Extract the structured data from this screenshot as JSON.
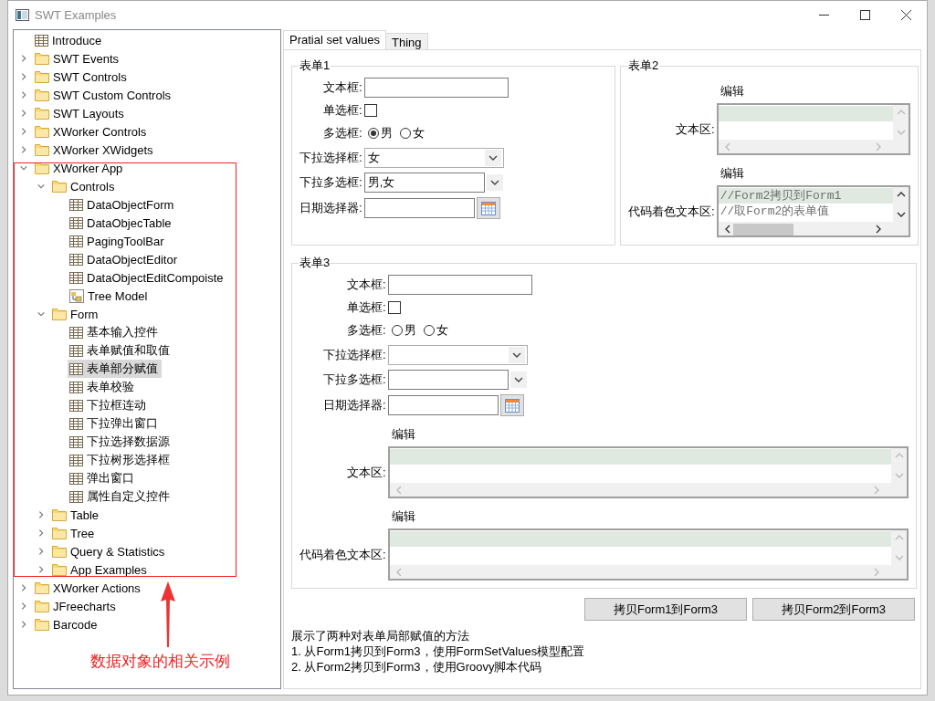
{
  "window": {
    "title": "SWT Examples"
  },
  "tree": [
    {
      "label": "Introduce",
      "kind": "page",
      "selected": false
    },
    {
      "label": "SWT Events",
      "kind": "folder",
      "expanded": false,
      "selected": false
    },
    {
      "label": "SWT Controls",
      "kind": "folder",
      "expanded": false,
      "selected": false
    },
    {
      "label": "SWT Custom Controls",
      "kind": "folder",
      "expanded": false,
      "selected": false
    },
    {
      "label": "SWT Layouts",
      "kind": "folder",
      "expanded": false,
      "selected": false
    },
    {
      "label": "XWorker Controls",
      "kind": "folder",
      "expanded": false,
      "selected": false
    },
    {
      "label": "XWorker XWidgets",
      "kind": "folder",
      "expanded": false,
      "selected": false
    },
    {
      "label": "XWorker App",
      "kind": "folder",
      "expanded": true,
      "selected": false,
      "children": [
        {
          "label": "Controls",
          "kind": "folder",
          "expanded": true,
          "selected": false,
          "children": [
            {
              "label": "DataObjectForm",
              "kind": "page",
              "selected": false
            },
            {
              "label": "DataObjecTable",
              "kind": "page",
              "selected": false
            },
            {
              "label": "PagingToolBar",
              "kind": "page",
              "selected": false
            },
            {
              "label": "DataObjectEditor",
              "kind": "page",
              "selected": false
            },
            {
              "label": "DataObjectEditCompoiste",
              "kind": "page",
              "selected": false
            },
            {
              "label": "Tree Model",
              "kind": "model",
              "selected": false
            }
          ]
        },
        {
          "label": "Form",
          "kind": "folder",
          "expanded": true,
          "selected": false,
          "children": [
            {
              "label": "基本输入控件",
              "kind": "page",
              "selected": false
            },
            {
              "label": "表单赋值和取值",
              "kind": "page",
              "selected": false
            },
            {
              "label": "表单部分赋值",
              "kind": "page",
              "selected": true
            },
            {
              "label": "表单校验",
              "kind": "page",
              "selected": false
            },
            {
              "label": "下拉框连动",
              "kind": "page",
              "selected": false
            },
            {
              "label": "下拉弹出窗口",
              "kind": "page",
              "selected": false
            },
            {
              "label": "下拉选择数据源",
              "kind": "page",
              "selected": false
            },
            {
              "label": "下拉树形选择框",
              "kind": "page",
              "selected": false
            },
            {
              "label": "弹出窗口",
              "kind": "page",
              "selected": false
            },
            {
              "label": "属性自定义控件",
              "kind": "page",
              "selected": false
            }
          ]
        },
        {
          "label": "Table",
          "kind": "folder",
          "expanded": false,
          "selected": false
        },
        {
          "label": "Tree",
          "kind": "folder",
          "expanded": false,
          "selected": false
        },
        {
          "label": "Query & Statistics",
          "kind": "folder",
          "expanded": false,
          "selected": false
        },
        {
          "label": "App Examples",
          "kind": "folder",
          "expanded": false,
          "selected": false
        }
      ]
    },
    {
      "label": "XWorker Actions",
      "kind": "folder",
      "expanded": false,
      "selected": false
    },
    {
      "label": "JFreecharts",
      "kind": "folder",
      "expanded": false,
      "selected": false
    },
    {
      "label": "Barcode",
      "kind": "folder",
      "expanded": false,
      "selected": false
    }
  ],
  "annotation": {
    "text": "数据对象的相关示例"
  },
  "tabs": [
    {
      "label": "Pratial set values",
      "selected": true
    },
    {
      "label": "Thing",
      "selected": false
    }
  ],
  "forms": [
    {
      "title": "表单1",
      "fields": [
        {
          "kind": "text",
          "label": "文本框:"
        },
        {
          "kind": "checkbox",
          "label": "单选框:",
          "checked": false
        },
        {
          "kind": "radio",
          "label": "多选框:",
          "options": [
            {
              "label": "男",
              "selected": true
            },
            {
              "label": "女",
              "selected": false
            }
          ]
        },
        {
          "kind": "select",
          "label": "下拉选择框:",
          "value": "女"
        },
        {
          "kind": "multiselect",
          "label": "下拉多选框:",
          "value": "男,女"
        },
        {
          "kind": "date",
          "label": "日期选择器:"
        }
      ]
    },
    {
      "title": "表单2",
      "fields": [
        {
          "kind": "textarea",
          "label": "文本区:",
          "caption": "编辑"
        },
        {
          "kind": "code",
          "label": "代码着色文本区:",
          "caption": "编辑",
          "lines": [
            "//Form2拷贝到Form1",
            "//取Form2的表单值"
          ]
        }
      ]
    },
    {
      "title": "表单3",
      "fields": [
        {
          "kind": "text",
          "label": "文本框:"
        },
        {
          "kind": "checkbox",
          "label": "单选框:",
          "checked": false
        },
        {
          "kind": "radio",
          "label": "多选框:",
          "options": [
            {
              "label": "男",
              "selected": false
            },
            {
              "label": "女",
              "selected": false
            }
          ]
        },
        {
          "kind": "select",
          "label": "下拉选择框:"
        },
        {
          "kind": "multiselect",
          "label": "下拉多选框:"
        },
        {
          "kind": "date",
          "label": "日期选择器:"
        },
        {
          "kind": "textarea",
          "label": "文本区:",
          "caption": "编辑"
        },
        {
          "kind": "code",
          "label": "代码着色文本区:",
          "caption": "编辑"
        }
      ]
    }
  ],
  "buttons": [
    "拷贝Form1到Form3",
    "拷贝Form2到Form3"
  ],
  "description": [
    "展示了两种对表单局部赋值的方法",
    "1. 从Form1拷贝到Form3，使用FormSetValues模型配置",
    "2. 从Form2拷贝到Form3，使用Groovy脚本代码"
  ]
}
